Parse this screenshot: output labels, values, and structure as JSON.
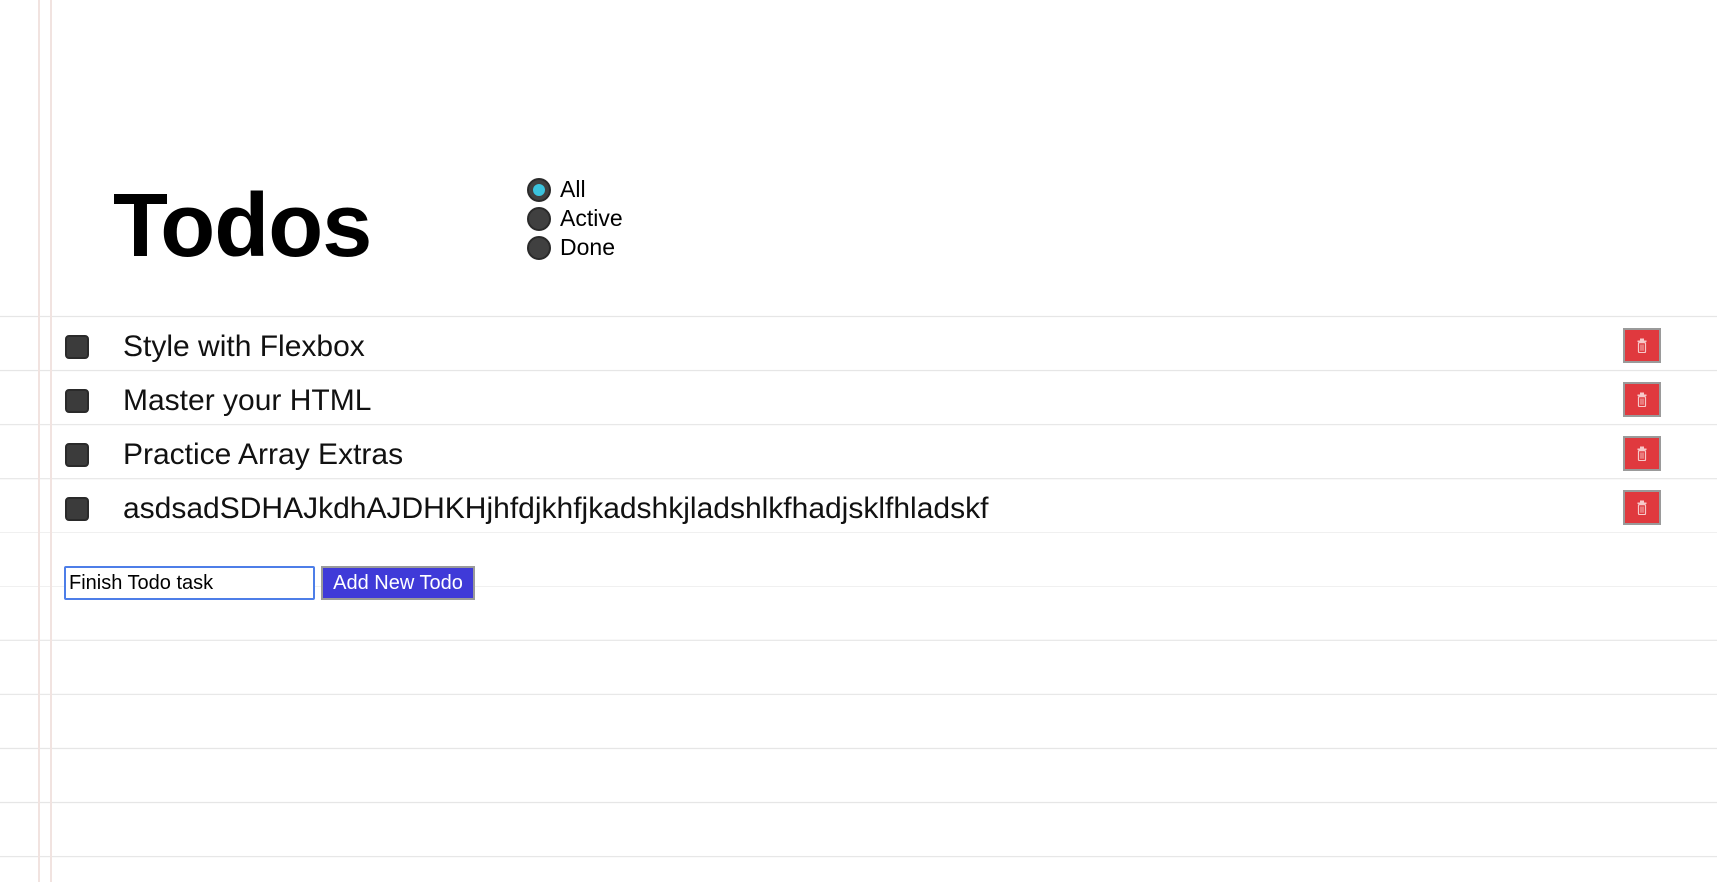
{
  "app": {
    "title": "Todos"
  },
  "filters": [
    {
      "label": "All",
      "checked": true
    },
    {
      "label": "Active",
      "checked": false
    },
    {
      "label": "Done",
      "checked": false
    }
  ],
  "todos": [
    {
      "text": "Style with Flexbox",
      "done": false
    },
    {
      "text": "Master your HTML",
      "done": false
    },
    {
      "text": "Practice Array Extras",
      "done": false
    },
    {
      "text": "asdsadSDHAJkdhAJDHKHjhfdjkhfjkadshkjladshlkfhadjsklfhladskf",
      "done": false
    }
  ],
  "new_todo": {
    "value": "Finish Todo task",
    "button_label": "Add New Todo"
  },
  "icons": {
    "delete": "trash-icon"
  },
  "colors": {
    "delete_button": "#e0393e",
    "add_button": "#3f3ad8",
    "radio_selected": "#3bc3dd",
    "input_focus_border": "#4d7ee8"
  }
}
